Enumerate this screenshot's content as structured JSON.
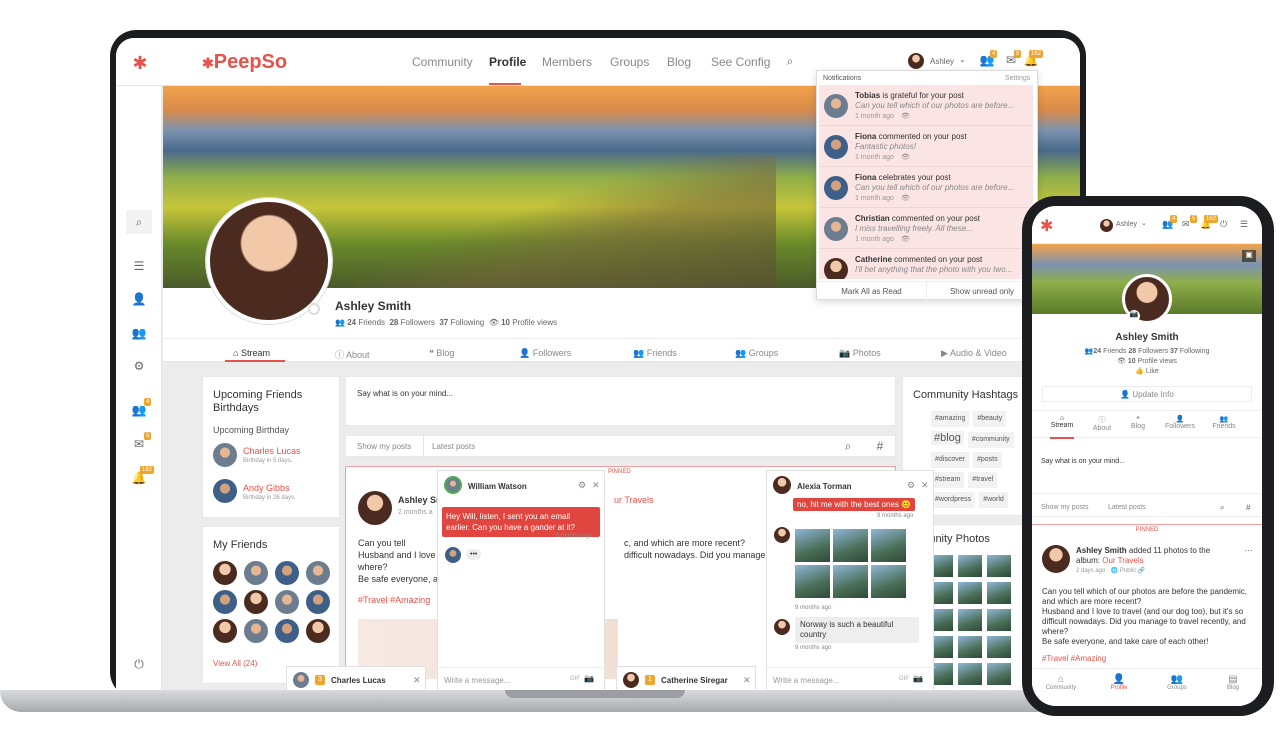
{
  "brand": {
    "name": "PeepSo",
    "accent": "#e8524a",
    "badge": "#f0a52a"
  },
  "topnav": {
    "items": [
      "Community",
      "Profile",
      "Members",
      "Groups",
      "Blog",
      "See Config"
    ],
    "active": "Profile",
    "user": "Ashley",
    "badges": [
      "4",
      "5",
      "162"
    ]
  },
  "leftbar": {
    "badges": [
      "4",
      "5",
      "162"
    ]
  },
  "profile": {
    "name": "Ashley Smith",
    "friends": "24",
    "friends_label": "Friends",
    "followers": "28",
    "followers_label": "Followers",
    "following": "37",
    "following_label": "Following",
    "views": "10",
    "views_label": "Profile views"
  },
  "tabs": [
    "Stream",
    "About",
    "Blog",
    "Followers",
    "Friends",
    "Groups",
    "Photos",
    "Audio & Video"
  ],
  "birthdays": {
    "title": "Upcoming Friends Birthdays",
    "subtitle": "Upcoming Birthday",
    "people": [
      {
        "name": "Charles Lucas",
        "note": "Birthday in 5 days."
      },
      {
        "name": "Andy Gibbs",
        "note": "Birthday in 26 days."
      }
    ]
  },
  "friends": {
    "title": "My Friends",
    "view_all": "View All (24)"
  },
  "composer": {
    "placeholder": "Say what is on your mind...",
    "tab1": "Show my posts",
    "tab2": "Latest posts"
  },
  "post": {
    "pinned": "PINNED",
    "author": "Ashley Sı",
    "time": "2 months a",
    "album": "ur Travels",
    "body": [
      "Can you tell which of our photos are before the pandemic, and which are more recent?",
      "Husband and I love to travel (and our dog too), but it's so difficult nowadays. Did you manage to travel recently, and where?",
      "Be safe everyone, and take care of each other!"
    ],
    "body_laptop": [
      "Can you tell",
      "Husband and I love",
      "where?",
      "Be safe everyone, a"
    ],
    "body_laptop_right": [
      "c, and which are more recent?",
      "difficult nowadays. Did you manage t"
    ],
    "tags": "#Travel #Amazing"
  },
  "hashtags": {
    "title": "Community Hashtags",
    "items": [
      "#amazing",
      "#beauty",
      "#blog",
      "#community",
      "#discover",
      "#posts",
      "#stream",
      "#travel",
      "#wordpress",
      "#world"
    ]
  },
  "community_photos": {
    "title": "mmunity Photos"
  },
  "notifications": {
    "title": "Notifications",
    "settings": "Settings",
    "mark_read": "Mark All as Read",
    "show_unread": "Show unread only",
    "items": [
      {
        "name": "Tobias",
        "action": "is grateful for your post",
        "text": "Can you tell which of our photos are before...",
        "time": "1 month ago"
      },
      {
        "name": "Fiona",
        "action": "commented on your post",
        "text": "Fantastic photos!",
        "time": "1 month ago"
      },
      {
        "name": "Fiona",
        "action": "celebrates your post",
        "text": "Can you tell which of our photos are before...",
        "time": "1 month ago"
      },
      {
        "name": "Christian",
        "action": "commented on your post",
        "text": "I miss travelling freely. All these...",
        "time": "1 month ago"
      },
      {
        "name": "Catherine",
        "action": "commented on your post",
        "text": "I'll bet anything that the photo with you two...",
        "time": ""
      }
    ]
  },
  "chat1": {
    "name": "William Watson",
    "message": "Hey Will, listen, I sent you an email earlier. Can you have a gander at it?",
    "time": "9 months ago",
    "typing": "•••",
    "placeholder": "Write a message..."
  },
  "chat2": {
    "name": "Alexia Torman",
    "top": "no, hit me with the best ones 😊",
    "time1": "9 months ago",
    "time2": "9 months ago",
    "message": "Norway is such a beautiful country",
    "time3": "9 months ago",
    "placeholder": "Write a message..."
  },
  "minichats": [
    {
      "name": "Charles Lucas",
      "count": "3"
    },
    {
      "name": "Catherine Siregar",
      "count": "1"
    }
  ],
  "mobile": {
    "user": "Ashley",
    "badges": [
      "4",
      "5",
      "162"
    ],
    "name": "Ashley Smith",
    "friends": "24",
    "friends_label": "Friends",
    "followers": "28",
    "followers_label": "Followers",
    "following": "37",
    "following_label": "Following",
    "views": "10",
    "views_label": "Profile views",
    "like": "Like",
    "update": "Update Info",
    "tabs": [
      "Stream",
      "About",
      "Blog",
      "Followers",
      "Friends"
    ],
    "composer": "Say what is on your mind...",
    "tab1": "Show my posts",
    "tab2": "Latest posts",
    "pinned": "PINNED",
    "author": "Ashley Smith",
    "added": "added 11 photos to the album:",
    "album": "Our Travels",
    "time": "2 days ago",
    "privacy": "Public",
    "tags": "#Travel #Amazing",
    "bottom": [
      "Community",
      "Profile",
      "Groups",
      "Blog"
    ]
  }
}
